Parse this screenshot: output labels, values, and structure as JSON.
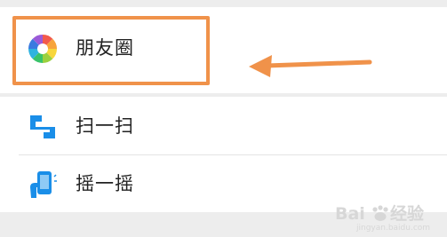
{
  "menu": {
    "moments": {
      "label": "朋友圈",
      "icon": "moments-aperture-icon"
    },
    "scan": {
      "label": "扫一扫",
      "icon": "scan-icon"
    },
    "shake": {
      "label": "摇一摇",
      "icon": "shake-phone-icon"
    }
  },
  "annotation": {
    "highlight_color": "#f0924a",
    "arrow_icon": "left-arrow-icon"
  },
  "watermark": {
    "text": "Bai",
    "paw_icon": "baidu-paw-icon",
    "cn": "经验",
    "sub": "jingyan.baidu.com"
  },
  "colors": {
    "background": "#ededed",
    "panel": "#ffffff",
    "icon_blue": "#1a8ee8",
    "annotation_orange": "#f0924a"
  }
}
